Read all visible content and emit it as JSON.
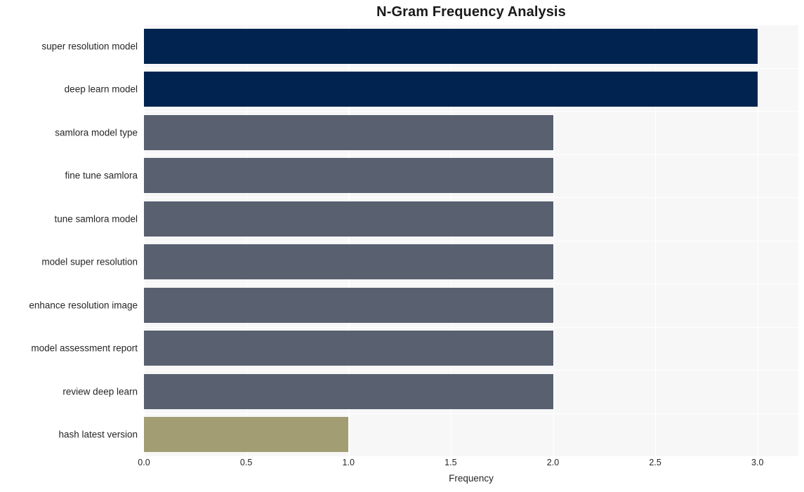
{
  "chart_data": {
    "type": "bar",
    "orientation": "horizontal",
    "title": "N-Gram Frequency Analysis",
    "xlabel": "Frequency",
    "ylabel": "",
    "xlim": [
      0,
      3.2
    ],
    "xticks": [
      0,
      0.5,
      1,
      1.5,
      2,
      2.5,
      3
    ],
    "xticklabels": [
      "0.0",
      "0.5",
      "1.0",
      "1.5",
      "2.0",
      "2.5",
      "3.0"
    ],
    "grid": true,
    "legend": false,
    "categories": [
      "super resolution model",
      "deep learn model",
      "samlora model type",
      "fine tune samlora",
      "tune samlora model",
      "model super resolution",
      "enhance resolution image",
      "model assessment report",
      "review deep learn",
      "hash latest version"
    ],
    "values": [
      3,
      3,
      2,
      2,
      2,
      2,
      2,
      2,
      2,
      1
    ],
    "bar_colors": [
      "#00244f",
      "#00244f",
      "#59606f",
      "#59606f",
      "#59606f",
      "#59606f",
      "#59606f",
      "#59606f",
      "#59606f",
      "#a39d73"
    ],
    "plot_background": "#f7f7f8",
    "grid_color": "#ffffff",
    "figure_background": "#ffffff"
  }
}
